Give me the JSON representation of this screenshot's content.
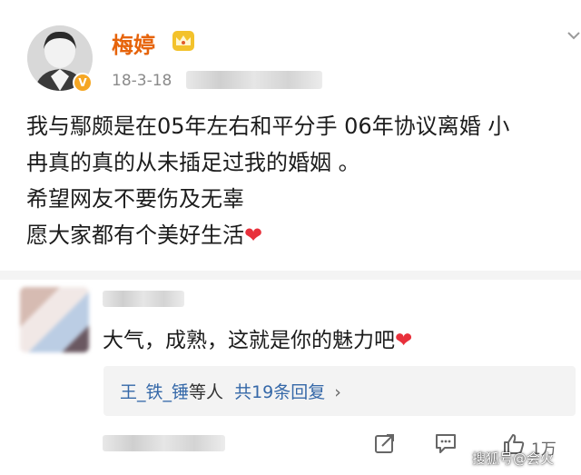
{
  "post": {
    "username": "梅婷",
    "date": "18-3-18",
    "verified_badge": "V",
    "lines": [
      "我与鄢颇是在05年左右和平分手  06年协议离婚 小",
      "冉真的真的从未插足过我的婚姻 。",
      "希望网友不要伤及无辜",
      "愿大家都有个美好生活"
    ],
    "heart": "❤"
  },
  "comment": {
    "text": "大气，成熟，这就是你的魅力吧",
    "heart": "❤"
  },
  "replies": {
    "names": "王_铁_锤",
    "suffix": "等人",
    "count_text": "共19条回复",
    "chevron": "›"
  },
  "actions": {
    "like_count": "1万"
  },
  "watermark": "搜狐号@会火",
  "colors": {
    "username": "#e6630a",
    "link": "#3568a8",
    "heart": "#e8303b",
    "verified": "#f5a623"
  },
  "icons": [
    "chevron-down-icon",
    "crown-icon",
    "verified-icon",
    "share-icon",
    "comment-icon",
    "like-icon"
  ]
}
